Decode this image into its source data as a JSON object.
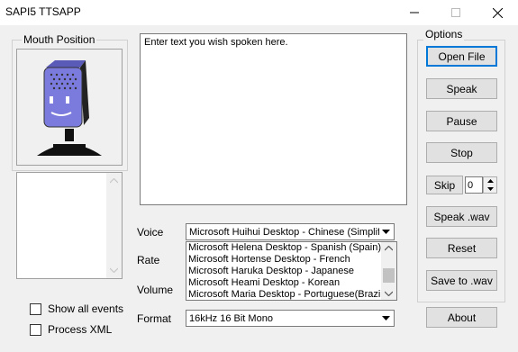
{
  "window": {
    "title": "SAPI5 TTSAPP"
  },
  "mouth_group": {
    "label": "Mouth Position"
  },
  "options_group": {
    "label": "Options"
  },
  "textarea": {
    "text": "Enter text you wish spoken here."
  },
  "checkboxes": {
    "show_all_events": "Show all events",
    "process_xml": "Process XML"
  },
  "labels": {
    "voice": "Voice",
    "rate": "Rate",
    "volume": "Volume",
    "format": "Format"
  },
  "voice": {
    "selected": "Microsoft Huihui Desktop - Chinese (Simplifie",
    "options": [
      "Microsoft Helena Desktop - Spanish (Spain)",
      "Microsoft Hortense Desktop - French",
      "Microsoft Haruka Desktop - Japanese",
      "Microsoft Heami Desktop - Korean",
      "Microsoft Maria Desktop - Portuguese(Brazil)"
    ]
  },
  "format": {
    "selected": "16kHz 16 Bit Mono"
  },
  "buttons": {
    "open_file": "Open File",
    "speak": "Speak",
    "pause": "Pause",
    "stop": "Stop",
    "skip": "Skip",
    "speak_wav": "Speak .wav",
    "reset": "Reset",
    "save_wav": "Save to .wav",
    "about": "About"
  },
  "skip_value": "0",
  "colors": {
    "mouth_body": "#7b7bde",
    "accent": "#0078d7"
  }
}
